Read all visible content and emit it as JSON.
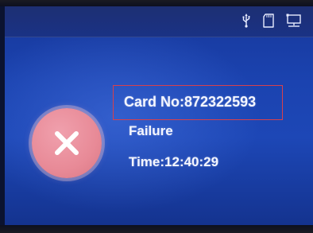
{
  "status_bar": {
    "icons": [
      "usb-icon",
      "sd-card-icon",
      "network-icon"
    ]
  },
  "result": {
    "icon": "x-mark-icon",
    "card_number_text": "Card No:872322593",
    "status_text": "Failure",
    "time_text": "Time:12:40:29"
  },
  "colors": {
    "screen_blue": "#1d47b6",
    "failure_icon_pink": "#e88a97",
    "highlight_box_red": "#d8404c",
    "text_white": "#f4f6ff"
  }
}
